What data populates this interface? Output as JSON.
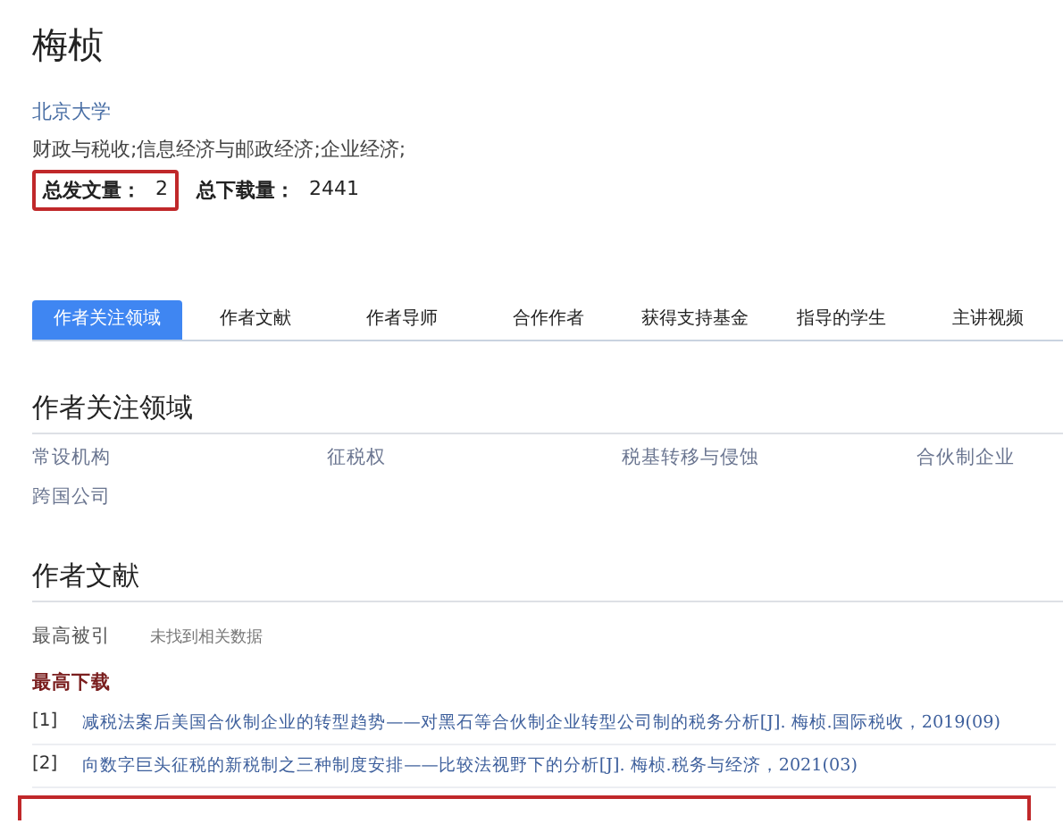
{
  "author": {
    "name": "梅桢",
    "affiliation": "北京大学",
    "subjects": "财政与税收;信息经济与邮政经济;企业经济;"
  },
  "stats": [
    {
      "label": "总发文量：",
      "value": "2",
      "highlighted": true
    },
    {
      "label": "总下载量：",
      "value": "2441",
      "highlighted": false
    }
  ],
  "tabs": [
    {
      "label": "作者关注领域",
      "selected": true
    },
    {
      "label": "作者文献",
      "selected": false
    },
    {
      "label": "作者导师",
      "selected": false
    },
    {
      "label": "合作作者",
      "selected": false
    },
    {
      "label": "获得支持基金",
      "selected": false
    },
    {
      "label": "指导的学生",
      "selected": false
    },
    {
      "label": "主讲视频",
      "selected": false
    }
  ],
  "focus_section": {
    "title": "作者关注领域",
    "items": [
      "常设机构",
      "征税权",
      "税基转移与侵蚀",
      "合伙制企业",
      "跨国公司"
    ]
  },
  "literature_section": {
    "title": "作者文献",
    "most_cited": {
      "label": "最高被引",
      "value": "未找到相关数据"
    },
    "most_downloaded": {
      "label": "最高下载",
      "items": [
        {
          "index": "[1]",
          "text": "减税法案后美国合伙制企业的转型趋势——对黑石等合伙制企业转型公司制的税务分析[J]. 梅桢.国际税收，2019(09)"
        },
        {
          "index": "[2]",
          "text": "向数字巨头征税的新税制之三种制度安排——比较法视野下的分析[J]. 梅桢.税务与经济，2021(03)"
        }
      ]
    }
  },
  "bottom_highlight": true
}
